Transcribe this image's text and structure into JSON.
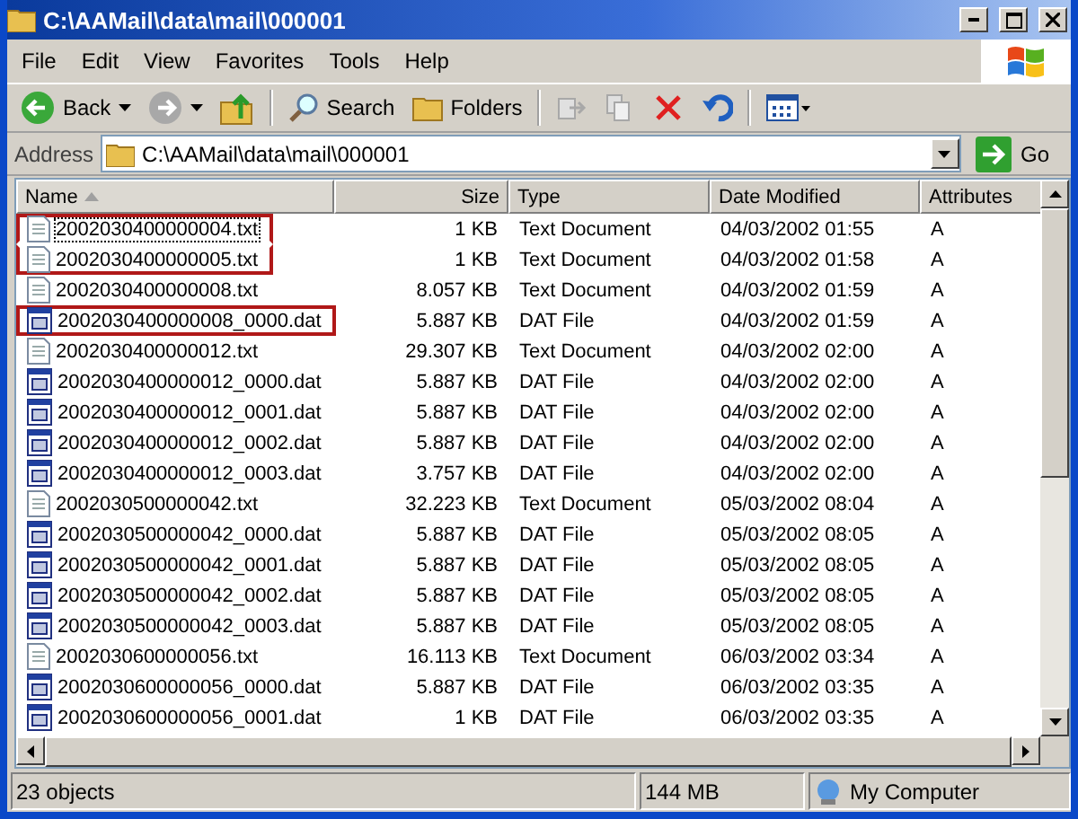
{
  "window": {
    "title": "C:\\AAMail\\data\\mail\\000001"
  },
  "menu": [
    "File",
    "Edit",
    "View",
    "Favorites",
    "Tools",
    "Help"
  ],
  "toolbar": [
    {
      "kind": "back",
      "label": "Back",
      "disabled": false
    },
    {
      "kind": "forward",
      "disabled": true
    },
    {
      "kind": "up",
      "disabled": false
    },
    {
      "kind": "search",
      "label": "Search",
      "disabled": false
    },
    {
      "kind": "folders",
      "label": "Folders",
      "disabled": false
    },
    {
      "kind": "move",
      "disabled": true
    },
    {
      "kind": "copy",
      "disabled": true
    },
    {
      "kind": "delete",
      "disabled": false
    },
    {
      "kind": "undo",
      "disabled": false
    },
    {
      "kind": "views",
      "disabled": false
    }
  ],
  "address": {
    "label": "Address",
    "value": "C:\\AAMail\\data\\mail\\000001",
    "go": "Go"
  },
  "columns": [
    {
      "label": "Name",
      "sorted": true
    },
    {
      "label": "Size",
      "sorted": false
    },
    {
      "label": "Type",
      "sorted": false
    },
    {
      "label": "Date Modified",
      "sorted": false
    },
    {
      "label": "Attributes",
      "sorted": false
    }
  ],
  "files": [
    {
      "kind": "txt",
      "name": "2002030400000004.txt",
      "size": "1 KB",
      "type": "Text Document",
      "modified": "04/03/2002 01:55",
      "attributes": "A",
      "highlighted": true,
      "focused": true
    },
    {
      "kind": "txt",
      "name": "2002030400000005.txt",
      "size": "1 KB",
      "type": "Text Document",
      "modified": "04/03/2002 01:58",
      "attributes": "A",
      "highlighted": true,
      "focused": false
    },
    {
      "kind": "txt",
      "name": "2002030400000008.txt",
      "size": "8.057 KB",
      "type": "Text Document",
      "modified": "04/03/2002 01:59",
      "attributes": "A",
      "highlighted": false,
      "focused": false
    },
    {
      "kind": "dat",
      "name": "2002030400000008_0000.dat",
      "size": "5.887 KB",
      "type": "DAT File",
      "modified": "04/03/2002 01:59",
      "attributes": "A",
      "highlighted": true,
      "focused": false
    },
    {
      "kind": "txt",
      "name": "2002030400000012.txt",
      "size": "29.307 KB",
      "type": "Text Document",
      "modified": "04/03/2002 02:00",
      "attributes": "A",
      "highlighted": false,
      "focused": false
    },
    {
      "kind": "dat",
      "name": "2002030400000012_0000.dat",
      "size": "5.887 KB",
      "type": "DAT File",
      "modified": "04/03/2002 02:00",
      "attributes": "A",
      "highlighted": false,
      "focused": false
    },
    {
      "kind": "dat",
      "name": "2002030400000012_0001.dat",
      "size": "5.887 KB",
      "type": "DAT File",
      "modified": "04/03/2002 02:00",
      "attributes": "A",
      "highlighted": false,
      "focused": false
    },
    {
      "kind": "dat",
      "name": "2002030400000012_0002.dat",
      "size": "5.887 KB",
      "type": "DAT File",
      "modified": "04/03/2002 02:00",
      "attributes": "A",
      "highlighted": false,
      "focused": false
    },
    {
      "kind": "dat",
      "name": "2002030400000012_0003.dat",
      "size": "3.757 KB",
      "type": "DAT File",
      "modified": "04/03/2002 02:00",
      "attributes": "A",
      "highlighted": false,
      "focused": false
    },
    {
      "kind": "txt",
      "name": "2002030500000042.txt",
      "size": "32.223 KB",
      "type": "Text Document",
      "modified": "05/03/2002 08:04",
      "attributes": "A",
      "highlighted": false,
      "focused": false
    },
    {
      "kind": "dat",
      "name": "2002030500000042_0000.dat",
      "size": "5.887 KB",
      "type": "DAT File",
      "modified": "05/03/2002 08:05",
      "attributes": "A",
      "highlighted": false,
      "focused": false
    },
    {
      "kind": "dat",
      "name": "2002030500000042_0001.dat",
      "size": "5.887 KB",
      "type": "DAT File",
      "modified": "05/03/2002 08:05",
      "attributes": "A",
      "highlighted": false,
      "focused": false
    },
    {
      "kind": "dat",
      "name": "2002030500000042_0002.dat",
      "size": "5.887 KB",
      "type": "DAT File",
      "modified": "05/03/2002 08:05",
      "attributes": "A",
      "highlighted": false,
      "focused": false
    },
    {
      "kind": "dat",
      "name": "2002030500000042_0003.dat",
      "size": "5.887 KB",
      "type": "DAT File",
      "modified": "05/03/2002 08:05",
      "attributes": "A",
      "highlighted": false,
      "focused": false
    },
    {
      "kind": "txt",
      "name": "2002030600000056.txt",
      "size": "16.113 KB",
      "type": "Text Document",
      "modified": "06/03/2002 03:34",
      "attributes": "A",
      "highlighted": false,
      "focused": false
    },
    {
      "kind": "dat",
      "name": "2002030600000056_0000.dat",
      "size": "5.887 KB",
      "type": "DAT File",
      "modified": "06/03/2002 03:35",
      "attributes": "A",
      "highlighted": false,
      "focused": false
    },
    {
      "kind": "dat",
      "name": "2002030600000056_0001.dat",
      "size": "1 KB",
      "type": "DAT File",
      "modified": "06/03/2002 03:35",
      "attributes": "A",
      "highlighted": false,
      "focused": false
    }
  ],
  "status_bar": {
    "count": "23 objects",
    "size": "144 MB",
    "zone": "My Computer"
  }
}
